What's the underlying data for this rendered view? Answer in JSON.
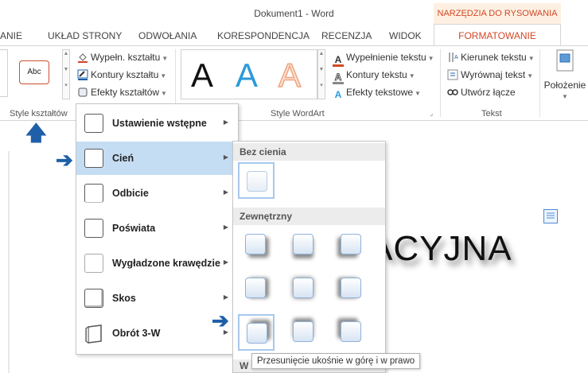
{
  "window": {
    "title": "Dokument1 - Word"
  },
  "context_tab_group": "NARZĘDZIA DO RYSOWANIA",
  "tabs": [
    {
      "label": "ANIE"
    },
    {
      "label": "UKŁAD STRONY"
    },
    {
      "label": "ODWOŁANIA"
    },
    {
      "label": "KORESPONDENCJA"
    },
    {
      "label": "RECENZJA"
    },
    {
      "label": "WIDOK"
    },
    {
      "label": "FORMATOWANIE"
    }
  ],
  "ribbon": {
    "shape_styles": {
      "sample_label": "Abc",
      "fill": "Wypełn. kształtu",
      "outline": "Kontury kształtu",
      "effects": "Efekty kształtów",
      "group_label": "Style kształtów"
    },
    "wordart": {
      "letters": [
        "A",
        "A",
        "A"
      ],
      "text_fill": "Wypełnienie tekstu",
      "text_outline": "Kontury tekstu",
      "text_effects": "Efekty tekstowe",
      "group_label": "Style WordArt"
    },
    "text": {
      "direction": "Kierunek tekstu",
      "align": "Wyrównaj tekst",
      "link": "Utwórz łącze",
      "group_label": "Tekst"
    },
    "position": {
      "label": "Położenie"
    }
  },
  "effects_menu": {
    "items": [
      {
        "label": "Ustawienie wstępne"
      },
      {
        "label": "Cień"
      },
      {
        "label": "Odbicie"
      },
      {
        "label": "Poświata"
      },
      {
        "label": "Wygładzone krawędzie"
      },
      {
        "label": "Skos"
      },
      {
        "label": "Obrót 3-W"
      }
    ]
  },
  "shadow_submenu": {
    "no_shadow": "Bez cienia",
    "outer": "Zewnętrzny",
    "next_header_partial": "W"
  },
  "document": {
    "text": "ACYJNA"
  },
  "tooltip": "Przesunięcie ukośnie w górę i w prawo",
  "colors": {
    "accent_orange": "#d24726",
    "menu_highlight": "#c5ddf3",
    "arrow_blue": "#1f5fa8"
  }
}
